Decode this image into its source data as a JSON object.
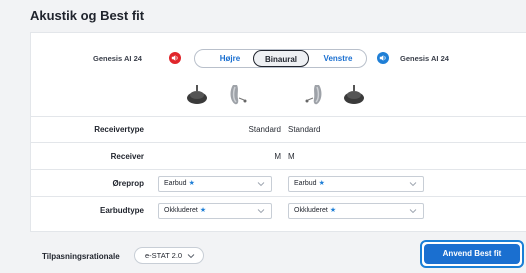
{
  "title": "Akustik og Best fit",
  "devices": {
    "left_model": "Genesis AI 24",
    "right_model": "Genesis AI 24"
  },
  "side_toggle": {
    "right": "Højre",
    "binaural": "Binaural",
    "left": "Venstre",
    "selected": "Binaural"
  },
  "rows": {
    "receivertype": {
      "label": "Receivertype",
      "left": "Standard",
      "right": "Standard"
    },
    "receiver": {
      "label": "Receiver",
      "left": "M",
      "right": "M"
    },
    "oreprop": {
      "label": "Øreprop",
      "left": "Earbud",
      "right": "Earbud"
    },
    "earbudtype": {
      "label": "Earbudtype",
      "left": "Okkluderet",
      "right": "Okkluderet"
    }
  },
  "star": "★",
  "rationale": {
    "label": "Tilpasningsrationale",
    "value": "e-STAT 2.0"
  },
  "apply_button": "Anvend Best fit",
  "colors": {
    "accent": "#1a6fd0",
    "right_ear": "#e0252b",
    "left_ear": "#1f7fd6"
  }
}
